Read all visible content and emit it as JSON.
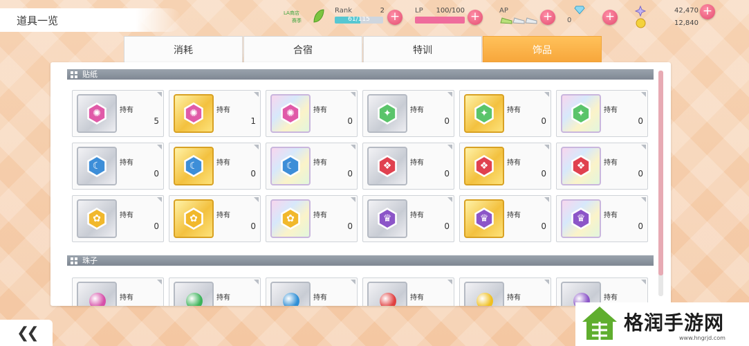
{
  "screen_title": "道具一览",
  "hud": {
    "badge_text_1": "LA商店",
    "badge_text_2": "赛季",
    "rank": {
      "label": "Rank",
      "value": "2",
      "bar_text": "61/115",
      "fill": 0.53
    },
    "lp": {
      "label": "LP",
      "value": "100/100",
      "fill": 1.0
    },
    "ap": {
      "label": "AP"
    },
    "gems": {
      "value": "0"
    },
    "currency": {
      "top": "42,470",
      "bottom": "12,840"
    },
    "plus": "+"
  },
  "tabs": [
    {
      "label": "消耗",
      "active": false
    },
    {
      "label": "合宿",
      "active": false
    },
    {
      "label": "特训",
      "active": false
    },
    {
      "label": "饰品",
      "active": true
    }
  ],
  "sections": [
    {
      "title": "贴纸"
    },
    {
      "title": "珠子"
    }
  ],
  "stickers": [
    {
      "label": "持有",
      "count": "5",
      "frame": "silver",
      "symbol": "✺",
      "color": "#e05aa8"
    },
    {
      "label": "持有",
      "count": "1",
      "frame": "gold",
      "symbol": "✺",
      "color": "#e05aa8"
    },
    {
      "label": "持有",
      "count": "0",
      "frame": "rainbow",
      "symbol": "✺",
      "color": "#e05aa8"
    },
    {
      "label": "持有",
      "count": "0",
      "frame": "silver",
      "symbol": "✦",
      "color": "#5ac46a"
    },
    {
      "label": "持有",
      "count": "0",
      "frame": "gold",
      "symbol": "✦",
      "color": "#5ac46a"
    },
    {
      "label": "持有",
      "count": "0",
      "frame": "rainbow",
      "symbol": "✦",
      "color": "#5ac46a"
    },
    {
      "label": "持有",
      "count": "0",
      "frame": "silver",
      "symbol": "☾",
      "color": "#3d8ed8"
    },
    {
      "label": "持有",
      "count": "0",
      "frame": "gold",
      "symbol": "☾",
      "color": "#3d8ed8"
    },
    {
      "label": "持有",
      "count": "0",
      "frame": "rainbow",
      "symbol": "☾",
      "color": "#3d8ed8"
    },
    {
      "label": "持有",
      "count": "0",
      "frame": "silver",
      "symbol": "❖",
      "color": "#e0414f"
    },
    {
      "label": "持有",
      "count": "0",
      "frame": "gold",
      "symbol": "❖",
      "color": "#e0414f"
    },
    {
      "label": "持有",
      "count": "0",
      "frame": "rainbow",
      "symbol": "❖",
      "color": "#e0414f"
    },
    {
      "label": "持有",
      "count": "0",
      "frame": "silver",
      "symbol": "✿",
      "color": "#f1b82c"
    },
    {
      "label": "持有",
      "count": "0",
      "frame": "gold",
      "symbol": "✿",
      "color": "#f1b82c"
    },
    {
      "label": "持有",
      "count": "0",
      "frame": "rainbow",
      "symbol": "✿",
      "color": "#f1b82c"
    },
    {
      "label": "持有",
      "count": "0",
      "frame": "silver",
      "symbol": "♛",
      "color": "#8c55c8"
    },
    {
      "label": "持有",
      "count": "0",
      "frame": "gold",
      "symbol": "♛",
      "color": "#8c55c8"
    },
    {
      "label": "持有",
      "count": "0",
      "frame": "rainbow",
      "symbol": "♛",
      "color": "#8c55c8"
    }
  ],
  "beads": [
    {
      "label": "持有",
      "color": "#d64fa9"
    },
    {
      "label": "持有",
      "color": "#3cb35a"
    },
    {
      "label": "持有",
      "color": "#2f8fd6"
    },
    {
      "label": "持有",
      "color": "#e04040"
    },
    {
      "label": "持有",
      "color": "#f0c020"
    },
    {
      "label": "持有",
      "color": "#8b55c8"
    }
  ],
  "back_button": "❮❮",
  "watermark": {
    "text": "格润手游网",
    "url": "www.hngrjd.com"
  },
  "colors": {
    "accent_tab": "#f7a63b",
    "lp_bar": "#ef6c9c",
    "rank_bar": "#56c7d2"
  }
}
